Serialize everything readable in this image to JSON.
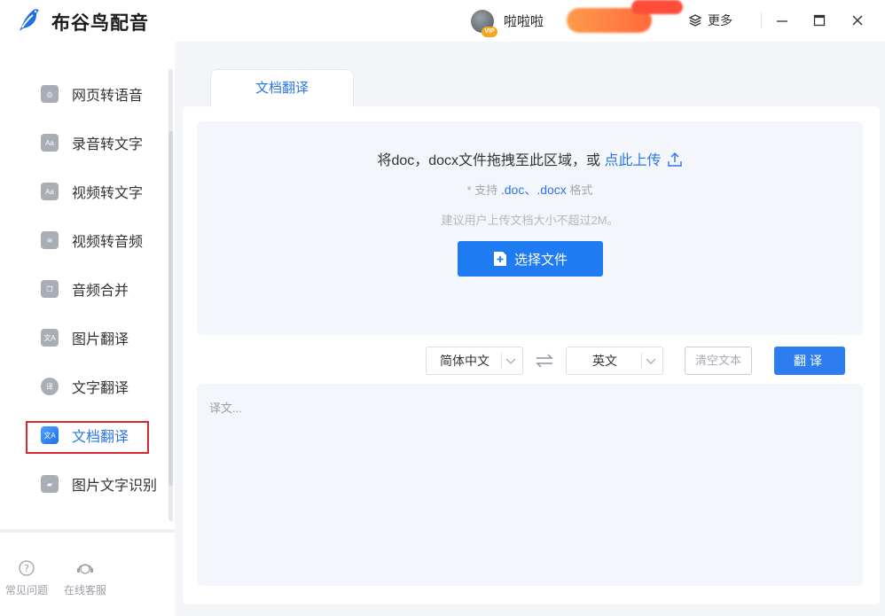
{
  "app": {
    "name": "布谷鸟配音",
    "brand_color": "#2d75e6"
  },
  "header": {
    "username": "啦啦啦",
    "vip_badge": "VIP",
    "more_label": "更多",
    "window_controls": [
      "minimize-icon",
      "maximize-icon",
      "close-icon"
    ]
  },
  "sidebar": {
    "items": [
      {
        "label": "网页转语音",
        "icon": "globe-icon",
        "glyph": "◎"
      },
      {
        "label": "录音转文字",
        "icon": "aa-text-icon",
        "glyph": "Aa"
      },
      {
        "label": "视频转文字",
        "icon": "video-text-icon",
        "glyph": "Aa"
      },
      {
        "label": "视频转音频",
        "icon": "video-audio-icon",
        "glyph": "≋"
      },
      {
        "label": "音频合并",
        "icon": "merge-icon",
        "glyph": "❐"
      },
      {
        "label": "图片翻译",
        "icon": "image-translate-icon",
        "glyph": "文A"
      },
      {
        "label": "文字翻译",
        "icon": "text-translate-icon",
        "glyph": "译"
      },
      {
        "label": "文档翻译",
        "icon": "doc-translate-icon",
        "glyph": "文A",
        "active": true
      },
      {
        "label": "图片文字识别",
        "icon": "image-ocr-icon",
        "glyph": "▰"
      }
    ],
    "footer": [
      {
        "label": "常见问题",
        "icon": "question-icon"
      },
      {
        "label": "在线客服",
        "icon": "headset-icon"
      }
    ]
  },
  "main": {
    "tab_label": "文档翻译",
    "dropzone": {
      "prompt": "将doc，docx文件拖拽至此区域，或",
      "upload_link": "点此上传",
      "support_prefix": "* 支持",
      "support_ext": ".doc、.docx",
      "support_suffix": "格式",
      "size_hint": "建议用户上传文档大小不超过2M。",
      "choose_button": "选择文件"
    },
    "source_lang": "简体中文",
    "target_lang": "英文",
    "clear_button": "清空文本",
    "translate_button": "翻译",
    "output_placeholder": "译文..."
  }
}
